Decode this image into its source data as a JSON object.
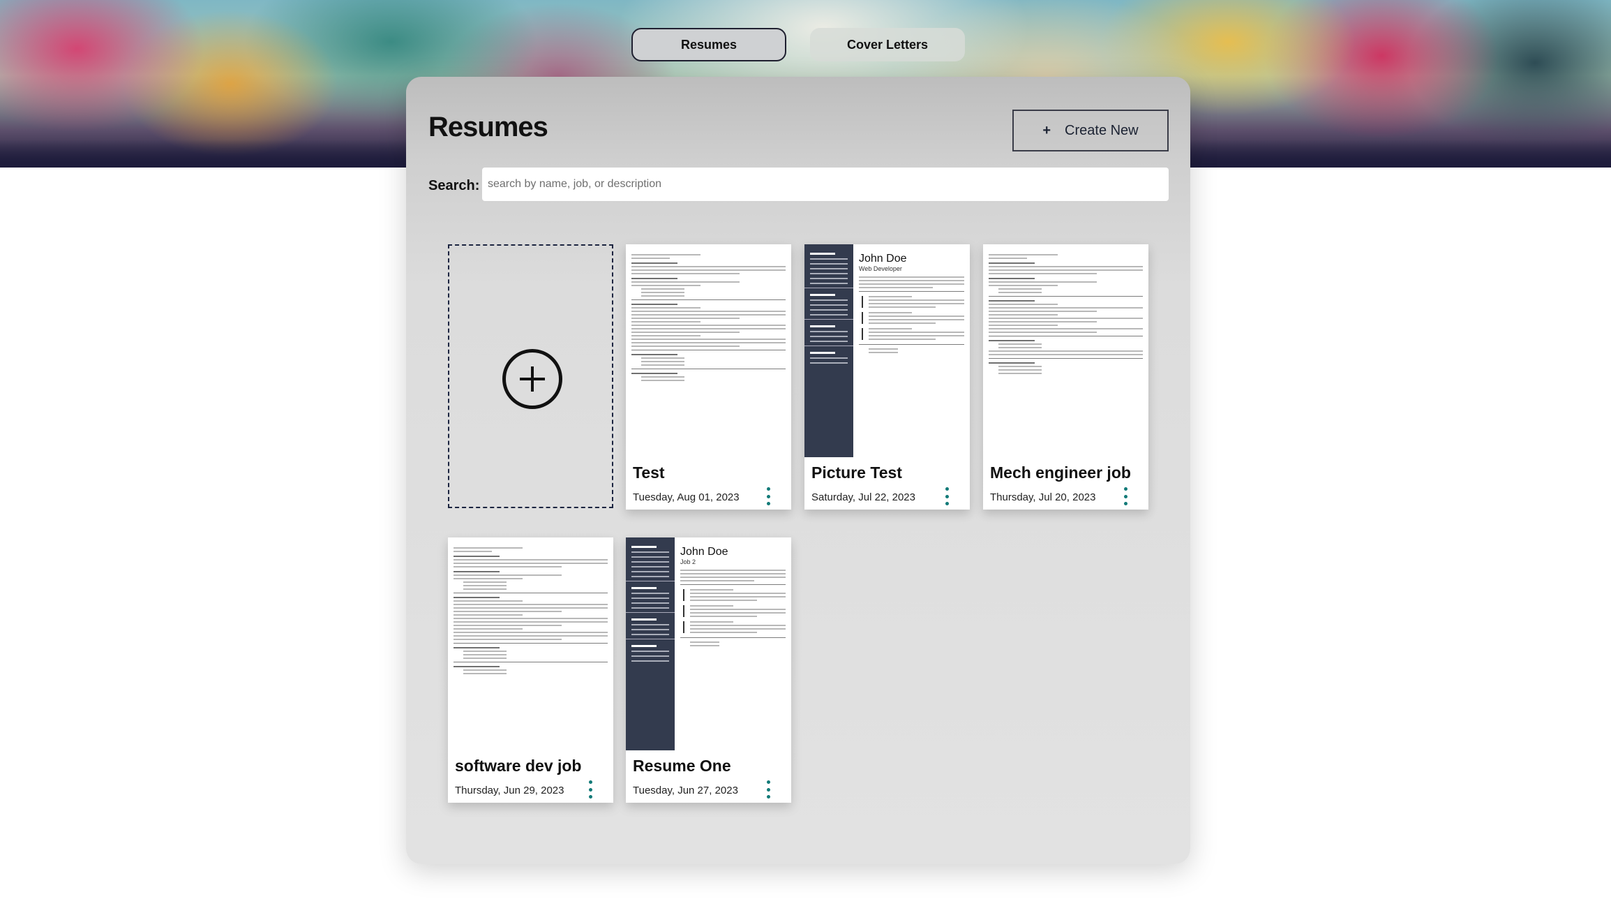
{
  "tabs": [
    {
      "label": "Resumes",
      "active": true
    },
    {
      "label": "Cover Letters",
      "active": false
    }
  ],
  "page": {
    "title": "Resumes",
    "create_button": {
      "icon": "+",
      "label": "Create New"
    },
    "search": {
      "label": "Search:",
      "placeholder": "search by name, job, or description",
      "value": ""
    }
  },
  "add_card": {
    "icon": "plus-circle-icon"
  },
  "resumes": [
    {
      "title": "Test",
      "date": "Tuesday, Aug 01, 2023",
      "template": "plain"
    },
    {
      "title": "Picture Test",
      "date": "Saturday, Jul 22, 2023",
      "template": "sidebar",
      "preview_name": "John Doe",
      "preview_job": "Web Developer"
    },
    {
      "title": "Mech engineer job",
      "date": "Thursday, Jul 20, 2023",
      "template": "plain"
    },
    {
      "title": "software dev job",
      "date": "Thursday, Jun 29, 2023",
      "template": "plain"
    },
    {
      "title": "Resume One",
      "date": "Tuesday, Jun 27, 2023",
      "template": "sidebar",
      "preview_name": "John Doe",
      "preview_job": "Job 2"
    }
  ],
  "colors": {
    "accent": "#127a78",
    "sidebar_dark": "#333b4e",
    "tab_border": "#1f2030"
  }
}
